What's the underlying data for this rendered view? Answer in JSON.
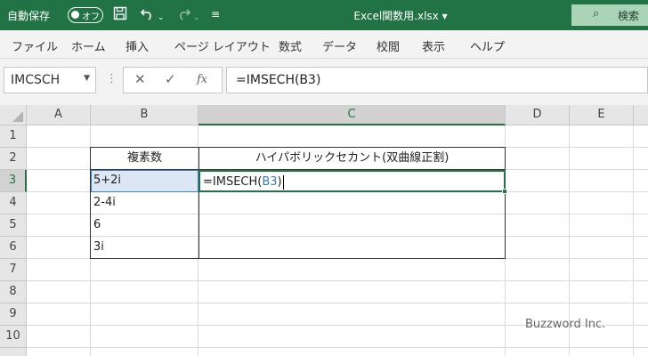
{
  "titlebar": {
    "autosave_label": "自動保存",
    "autosave_state": "オフ",
    "filename": "Excel関数用.xlsx",
    "search_label": "検索"
  },
  "menu": [
    "ファイル",
    "ホーム",
    "挿入",
    "ページ レイアウト",
    "数式",
    "データ",
    "校閲",
    "表示",
    "ヘルプ"
  ],
  "formula_bar": {
    "name_box": "IMCSCH",
    "cancel_icon": "✕",
    "enter_icon": "✓",
    "fx_label": "fx",
    "formula": "=IMSECH(B3)"
  },
  "grid": {
    "columns": [
      "A",
      "B",
      "C",
      "D",
      "E"
    ],
    "rows": [
      "1",
      "2",
      "3",
      "4",
      "5",
      "6",
      "7",
      "8",
      "9",
      "10"
    ],
    "selected_column": "C",
    "selected_row": "3"
  },
  "table": {
    "header_b": "複素数",
    "header_c": "ハイパボリックセカント(双曲線正割)",
    "b_values": [
      "5+2i",
      "2-4i",
      "6",
      "3i"
    ]
  },
  "editing": {
    "prefix": "=IMSECH(",
    "ref": "B3",
    "suffix": ")"
  },
  "watermark": "Buzzword Inc.",
  "colors": {
    "excel_green": "#217346",
    "reference_blue": "#3a78c4"
  }
}
